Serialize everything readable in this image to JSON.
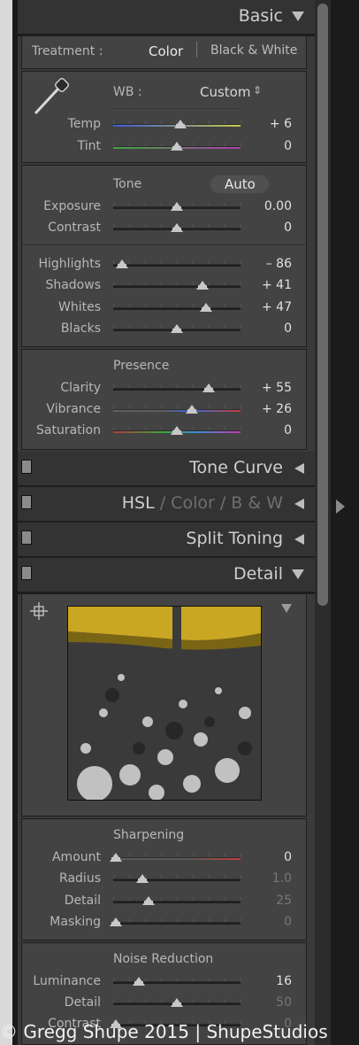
{
  "basic": {
    "title": "Basic",
    "treatment_label": "Treatment :",
    "treatment_color": "Color",
    "treatment_bw": "Black & White",
    "wb_label": "WB :",
    "wb_value": "Custom",
    "wb_arrows": "⇕",
    "temp": {
      "label": "Temp",
      "value": "+ 6",
      "level": 0.53
    },
    "tint": {
      "label": "Tint",
      "value": "0",
      "level": 0.5
    },
    "tone_label": "Tone",
    "auto_label": "Auto",
    "exposure": {
      "label": "Exposure",
      "value": "0.00",
      "level": 0.5
    },
    "contrast": {
      "label": "Contrast",
      "value": "0",
      "level": 0.5
    },
    "highlights": {
      "label": "Highlights",
      "value": "– 86",
      "level": 0.07
    },
    "shadows": {
      "label": "Shadows",
      "value": "+ 41",
      "level": 0.7
    },
    "whites": {
      "label": "Whites",
      "value": "+ 47",
      "level": 0.73
    },
    "blacks": {
      "label": "Blacks",
      "value": "0",
      "level": 0.5
    },
    "presence_label": "Presence",
    "clarity": {
      "label": "Clarity",
      "value": "+ 55",
      "level": 0.75
    },
    "vibrance": {
      "label": "Vibrance",
      "value": "+ 26",
      "level": 0.62
    },
    "saturation": {
      "label": "Saturation",
      "value": "0",
      "level": 0.5
    }
  },
  "tone_curve": {
    "title": "Tone Curve"
  },
  "hsl": {
    "title_hsl": "HSL",
    "slash1": "/",
    "title_color": "Color",
    "slash2": "/",
    "title_bw": "B & W"
  },
  "split_toning": {
    "title": "Split Toning"
  },
  "detail": {
    "title": "Detail",
    "sharpening_label": "Sharpening",
    "amount": {
      "label": "Amount",
      "value": "0",
      "level": 0.02
    },
    "radius": {
      "label": "Radius",
      "value": "1.0",
      "level": 0.23
    },
    "detail": {
      "label": "Detail",
      "value": "25",
      "level": 0.28
    },
    "masking": {
      "label": "Masking",
      "value": "0",
      "level": 0.02
    },
    "noise_label": "Noise Reduction",
    "luminance": {
      "label": "Luminance",
      "value": "16",
      "level": 0.2
    },
    "nr_detail": {
      "label": "Detail",
      "value": "50",
      "level": 0.5
    },
    "nr_contrast": {
      "label": "Contrast",
      "value": "0",
      "level": 0.02
    }
  },
  "watermark": "© Gregg Shupe 2015 | ShupeStudios",
  "icons": {
    "eyedropper": "eyedropper-icon",
    "target": "target-crosshair-icon",
    "expand": "triangle-down-icon",
    "collapse": "triangle-left-icon"
  },
  "colors": {
    "panel": "#3a3a3a",
    "header": "#333333",
    "accent_red": "#c23c3c",
    "accent_yellow": "#c8b400"
  }
}
